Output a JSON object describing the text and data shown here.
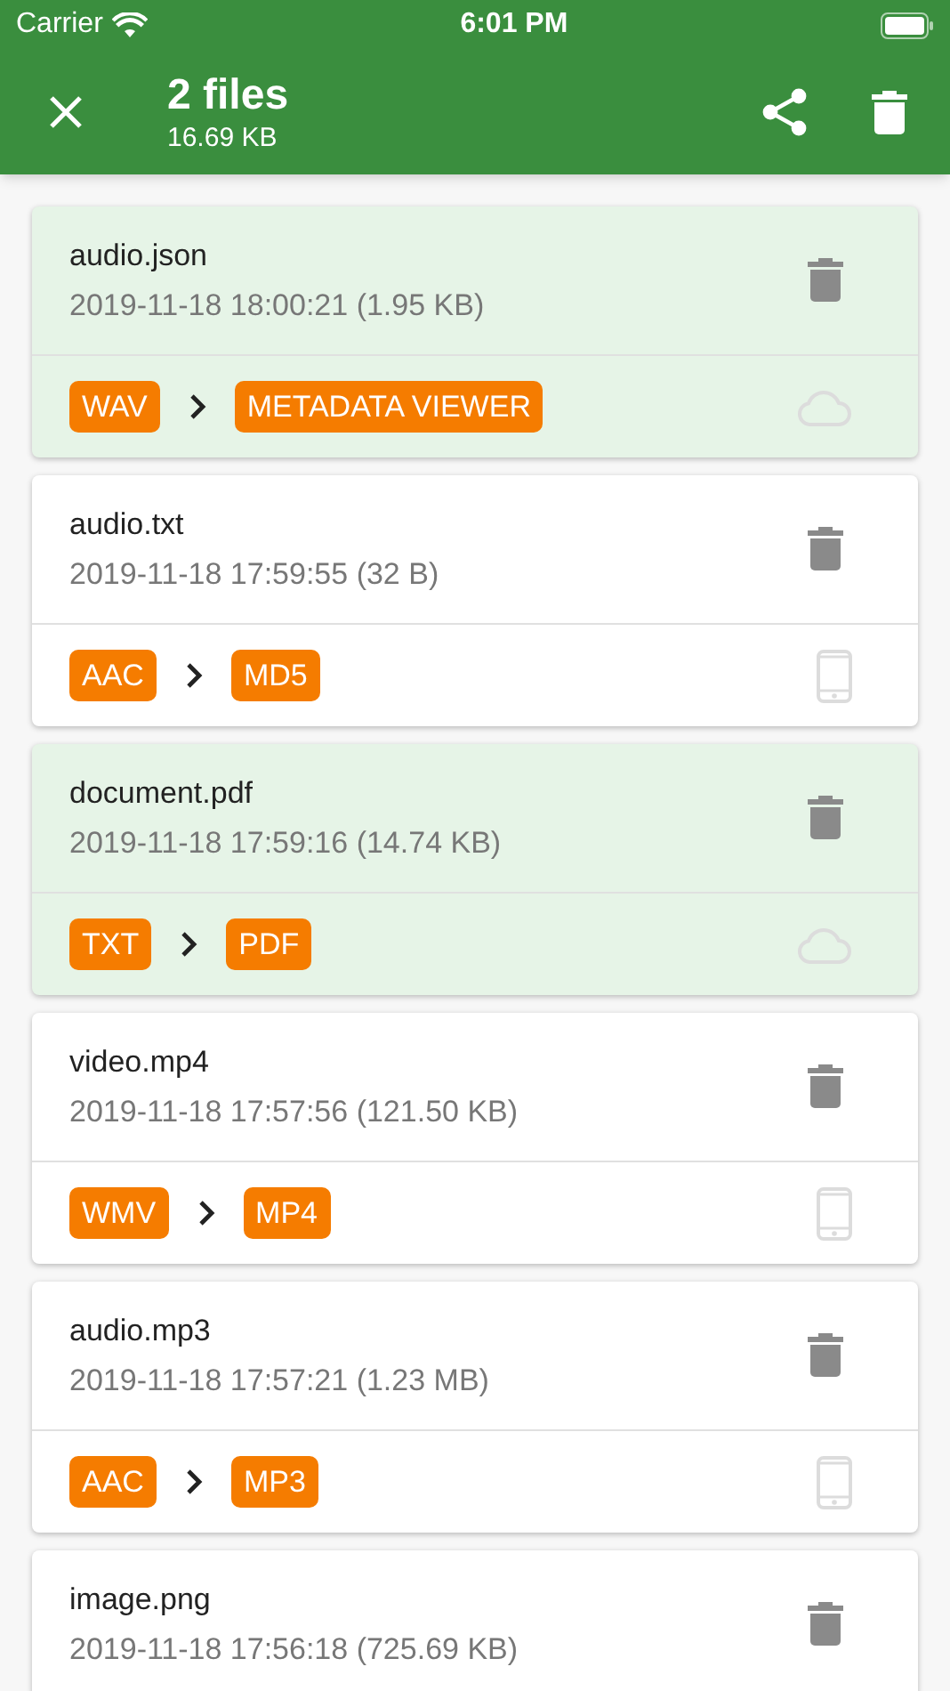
{
  "status_bar": {
    "carrier": "Carrier",
    "time": "6:01 PM"
  },
  "app_bar": {
    "title": "2 files",
    "subtitle": "16.69 KB"
  },
  "files": [
    {
      "name": "audio.json",
      "details": "2019-11-18 18:00:21 (1.95 KB)",
      "selected": true,
      "from": "WAV",
      "to": "METADATA VIEWER",
      "kind": "cloud"
    },
    {
      "name": "audio.txt",
      "details": "2019-11-18 17:59:55 (32 B)",
      "selected": false,
      "from": "AAC",
      "to": "MD5",
      "kind": "device"
    },
    {
      "name": "document.pdf",
      "details": "2019-11-18 17:59:16 (14.74 KB)",
      "selected": true,
      "from": "TXT",
      "to": "PDF",
      "kind": "cloud"
    },
    {
      "name": "video.mp4",
      "details": "2019-11-18 17:57:56 (121.50 KB)",
      "selected": false,
      "from": "WMV",
      "to": "MP4",
      "kind": "device"
    },
    {
      "name": "audio.mp3",
      "details": "2019-11-18 17:57:21 (1.23 MB)",
      "selected": false,
      "from": "AAC",
      "to": "MP3",
      "kind": "device"
    },
    {
      "name": "image.png",
      "details": "2019-11-18 17:56:18 (725.69 KB)",
      "selected": false
    }
  ]
}
